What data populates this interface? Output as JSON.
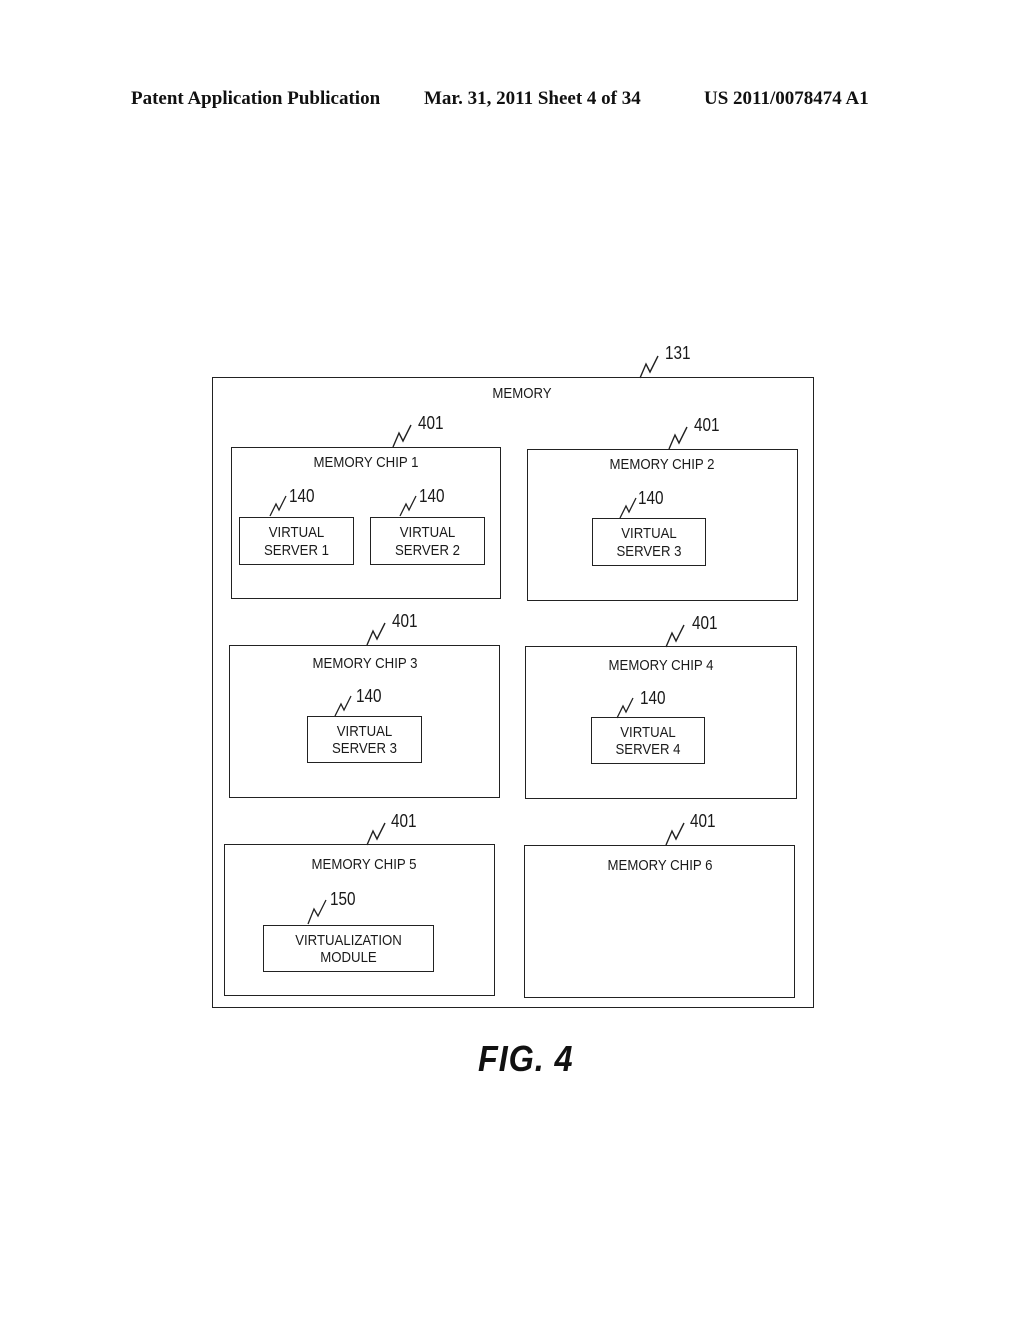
{
  "header": {
    "publication": "Patent Application Publication",
    "date_sheet": "Mar. 31, 2011  Sheet 4 of 34",
    "number": "US 2011/0078474 A1"
  },
  "figure": {
    "label": "FIG. 4",
    "memory": {
      "label": "MEMORY",
      "ref": "131"
    },
    "chips": [
      {
        "label": "MEMORY CHIP 1",
        "ref": "401",
        "modules": [
          {
            "line1": "VIRTUAL",
            "line2": "SERVER 1",
            "ref": "140"
          },
          {
            "line1": "VIRTUAL",
            "line2": "SERVER 2",
            "ref": "140"
          }
        ]
      },
      {
        "label": "MEMORY CHIP 2",
        "ref": "401",
        "modules": [
          {
            "line1": "VIRTUAL",
            "line2": "SERVER 3",
            "ref": "140"
          }
        ]
      },
      {
        "label": "MEMORY CHIP 3",
        "ref": "401",
        "modules": [
          {
            "line1": "VIRTUAL",
            "line2": "SERVER 3",
            "ref": "140"
          }
        ]
      },
      {
        "label": "MEMORY CHIP 4",
        "ref": "401",
        "modules": [
          {
            "line1": "VIRTUAL",
            "line2": "SERVER 4",
            "ref": "140"
          }
        ]
      },
      {
        "label": "MEMORY CHIP 5",
        "ref": "401",
        "modules": [
          {
            "line1": "VIRTUALIZATION",
            "line2": "MODULE",
            "ref": "150"
          }
        ]
      },
      {
        "label": "MEMORY CHIP 6",
        "ref": "401",
        "modules": []
      }
    ]
  }
}
